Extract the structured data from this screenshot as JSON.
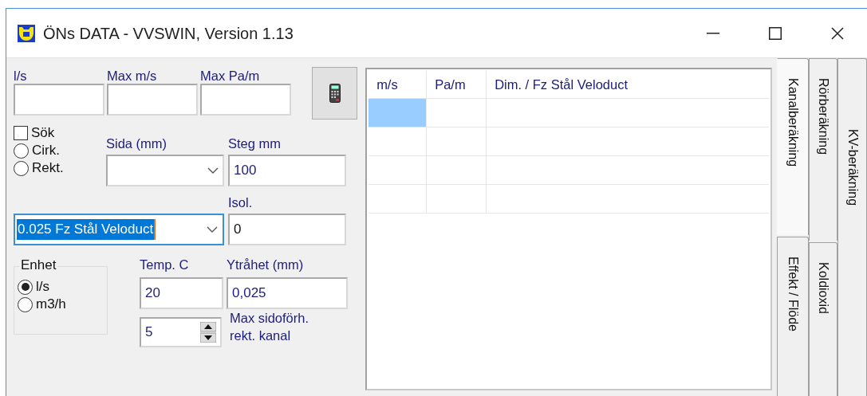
{
  "window": {
    "title": "ÖNs DATA - VVSWIN, Version 1.13"
  },
  "flow_inputs": [
    {
      "label": "l/s"
    },
    {
      "label": "Max m/s"
    },
    {
      "label": "Max Pa/m"
    }
  ],
  "search": {
    "label": "Sök",
    "checked": false
  },
  "shape": [
    {
      "label": "Cirk.",
      "selected": false
    },
    {
      "label": "Rekt.",
      "selected": false
    }
  ],
  "side": {
    "label": "Sida (mm)"
  },
  "step": {
    "label": "Steg mm",
    "value": "100"
  },
  "material": {
    "value": "0.025 Fz Stål Veloduct",
    "text_selected": true
  },
  "insulation": {
    "label": "Isol.",
    "value": "0"
  },
  "unit": {
    "title": "Enhet",
    "options": [
      {
        "label": "l/s",
        "selected": true
      },
      {
        "label": "m3/h",
        "selected": false
      }
    ]
  },
  "temperature": {
    "label": "Temp. C",
    "value": "20"
  },
  "roughness": {
    "label": "Ytråhet (mm)",
    "value": "0,025"
  },
  "aspect": {
    "value": "5",
    "label": "Max sidoförh.\nrekt. kanal"
  },
  "results": {
    "columns": [
      "m/s",
      "Pa/m",
      "Dim. / Fz Stål Veloduct"
    ],
    "rows": [
      {
        "focused": true
      },
      {
        "focused": false
      },
      {
        "focused": false
      },
      {
        "focused": false
      }
    ]
  },
  "tab_columns": [
    {
      "tabs": [
        {
          "label": "Kanalberäkning",
          "selected": true
        },
        {
          "label": "Effekt / Flöde",
          "selected": false
        }
      ]
    },
    {
      "tabs": [
        {
          "label": "Rörberäkning",
          "selected": false
        },
        {
          "label": "Koldioxid",
          "selected": false
        }
      ]
    },
    {
      "tabs": [
        {
          "label": "KV-beräkning",
          "selected": false
        }
      ]
    }
  ]
}
